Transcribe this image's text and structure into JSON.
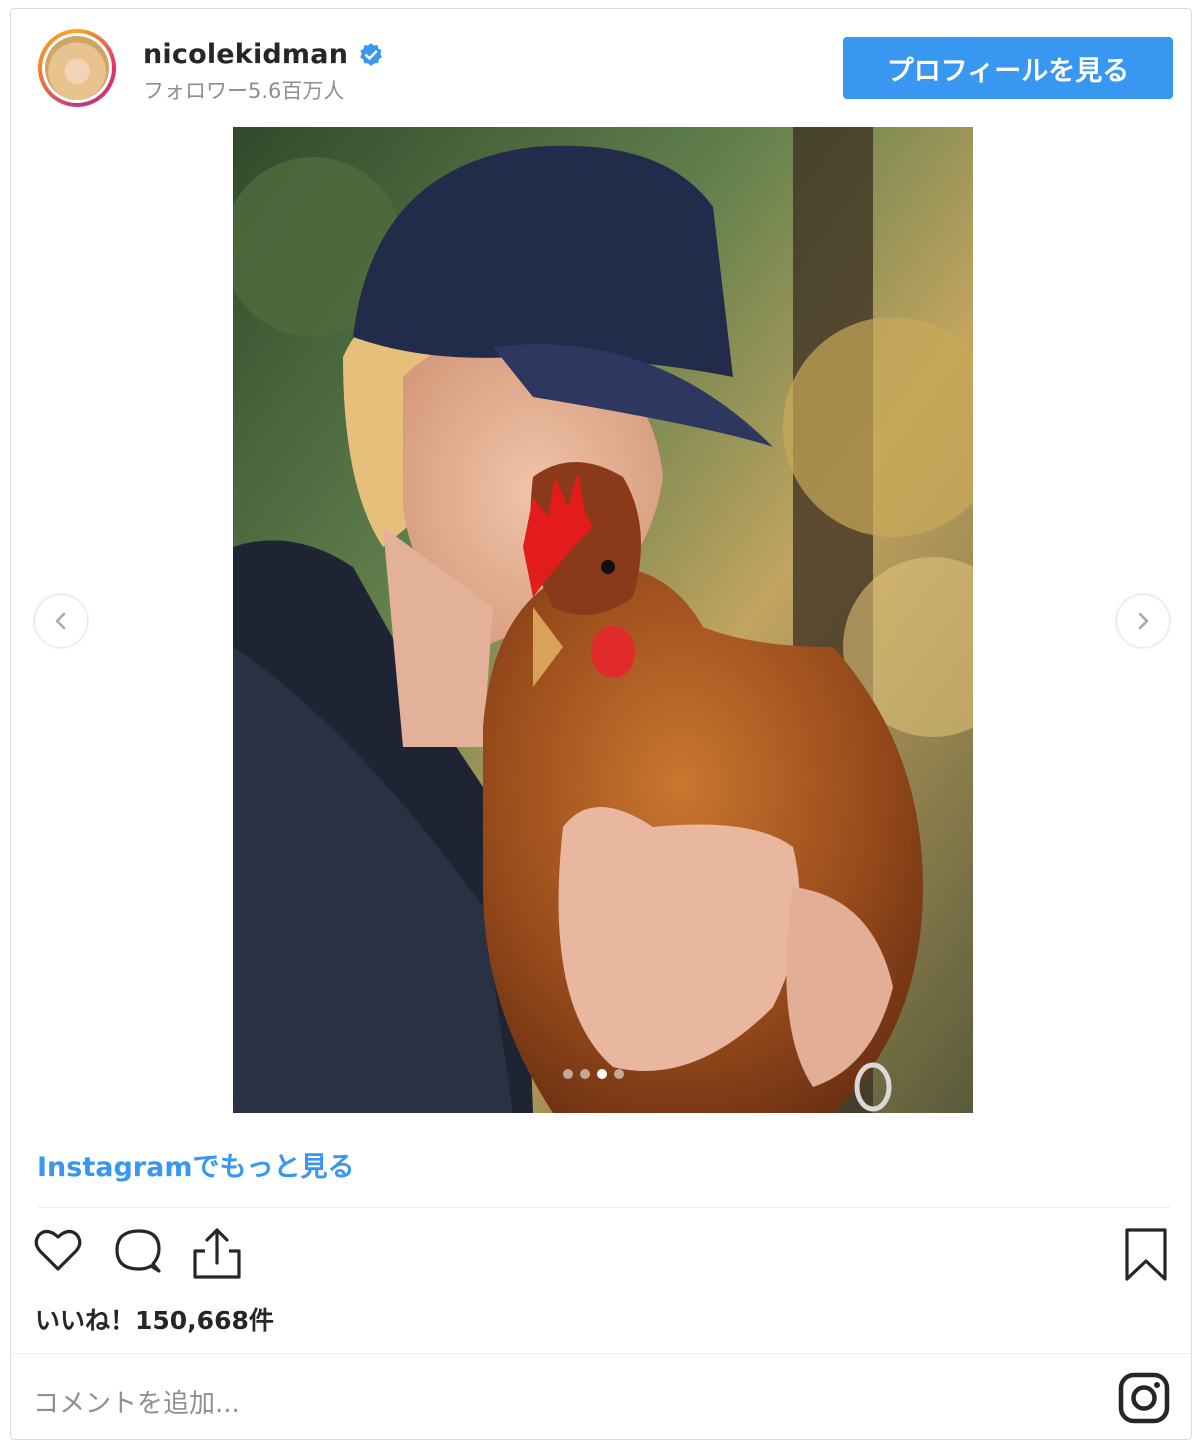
{
  "header": {
    "username": "nicolekidman",
    "followers": "フォロワー5.6百万人",
    "profile_button": "プロフィールを見る"
  },
  "photo": {
    "description": "photo",
    "carousel_count": 4,
    "carousel_active_index": 2
  },
  "links": {
    "more_on_instagram": "Instagramでもっと見る"
  },
  "actions": {
    "like_icon": "heart-icon",
    "comment_icon": "comment-icon",
    "share_icon": "share-icon",
    "save_icon": "bookmark-icon"
  },
  "likes": "いいね！150,668件",
  "comment_placeholder": "コメントを追加...",
  "colors": {
    "accent": "#3897f0",
    "muted": "#8e8e8e",
    "text": "#262626"
  }
}
